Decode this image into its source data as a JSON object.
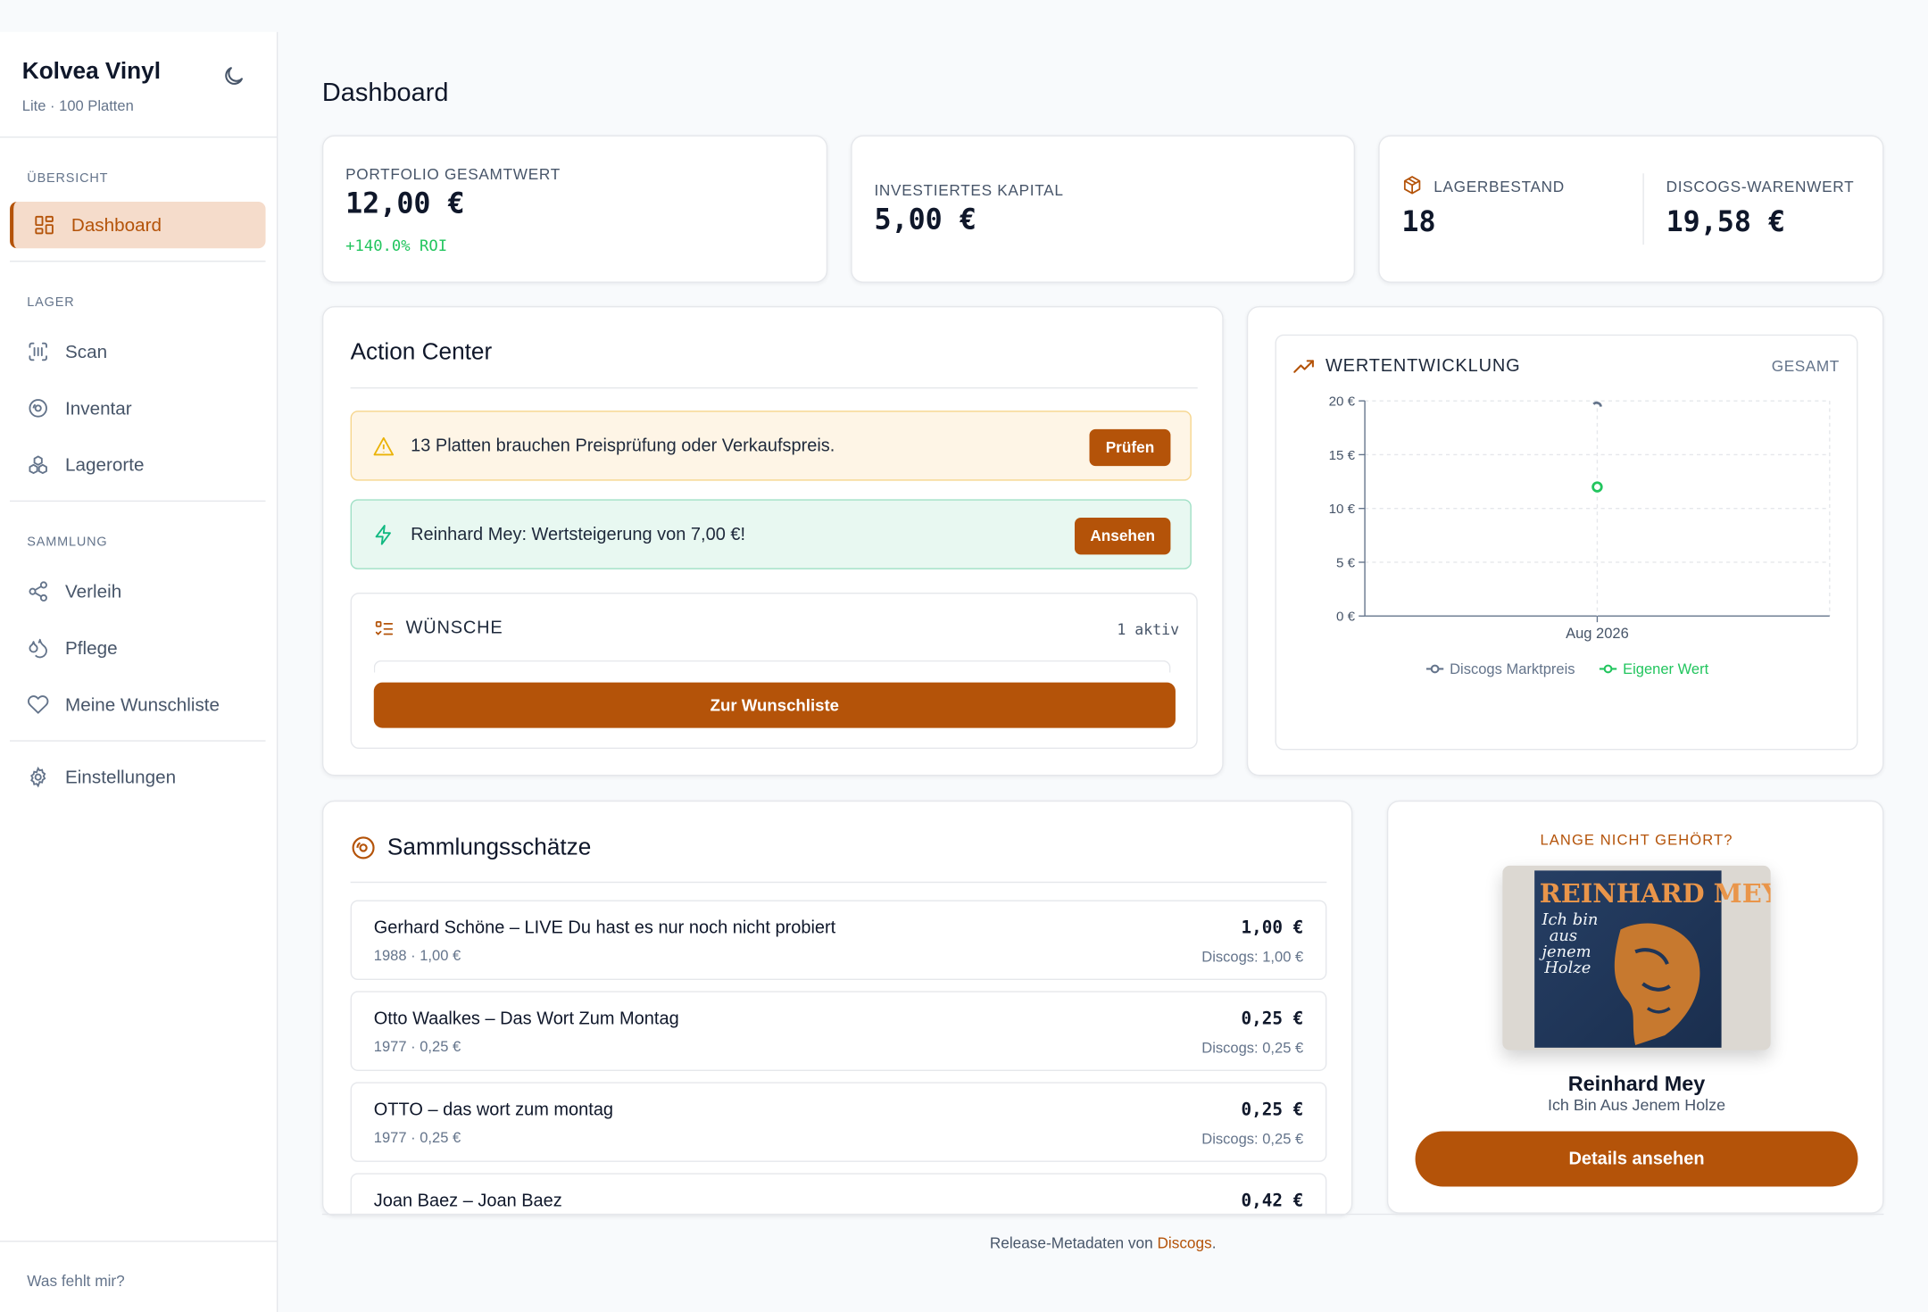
{
  "app": {
    "name": "Kolvea Vinyl",
    "plan": "Lite · 100 Platten"
  },
  "sidebar": {
    "sections": [
      {
        "title": "Übersicht",
        "items": [
          {
            "label": "Dashboard",
            "icon": "grid-icon",
            "active": true
          }
        ]
      },
      {
        "title": "Lager",
        "items": [
          {
            "label": "Scan",
            "icon": "barcode-scan-icon"
          },
          {
            "label": "Inventar",
            "icon": "vinyl-disc-icon"
          },
          {
            "label": "Lagerorte",
            "icon": "boxes-icon"
          }
        ]
      },
      {
        "title": "Sammlung",
        "items": [
          {
            "label": "Verleih",
            "icon": "share-icon"
          },
          {
            "label": "Pflege",
            "icon": "droplets-icon"
          },
          {
            "label": "Meine Wunschliste",
            "icon": "heart-icon"
          }
        ]
      }
    ],
    "settings_label": "Einstellungen",
    "footer_link": "Was fehlt mir?"
  },
  "page": {
    "title": "Dashboard"
  },
  "kpis": {
    "portfolio": {
      "label": "Portfolio Gesamtwert",
      "value": "12,00 €",
      "roi": "+140.0% ROI"
    },
    "invested": {
      "label": "Investiertes Kapital",
      "value": "5,00 €"
    },
    "stock": {
      "label": "Lagerbestand",
      "value": "18"
    },
    "discogs": {
      "label": "Discogs-Warenwert",
      "value": "19,58 €"
    }
  },
  "action_center": {
    "title": "Action Center",
    "alerts": [
      {
        "text": "13 Platten brauchen Preisprüfung oder Verkaufspreis.",
        "button": "Prüfen",
        "kind": "warning",
        "bg": "#fef5e6",
        "border": "#f6d58c",
        "icon_color": "#eab308"
      },
      {
        "text": "Reinhard Mey: Wertsteigerung von 7,00 €!",
        "button": "Ansehen",
        "kind": "success",
        "bg": "#e8f8f1",
        "border": "#9fe0c5",
        "icon_color": "#10b981"
      }
    ],
    "wishes": {
      "title": "Wünsche",
      "count": "1 aktiv",
      "button": "Zur Wunschliste"
    }
  },
  "chart_card": {
    "title": "Wertentwicklung",
    "range": "Gesamt"
  },
  "chart_data": {
    "type": "line",
    "x": [
      "Aug 2026"
    ],
    "series": [
      {
        "name": "Discogs Marktpreis",
        "values": [
          19.58
        ],
        "color": "#64748b"
      },
      {
        "name": "Eigener Wert",
        "values": [
          12
        ],
        "color": "#22c55e"
      }
    ],
    "yticks": [
      "0 €",
      "5 €",
      "10 €",
      "15 €",
      "20 €"
    ],
    "ylim": [
      0,
      20
    ],
    "grid": true,
    "legend": "bottom"
  },
  "treasures": {
    "title": "Sammlungsschätze",
    "items": [
      {
        "name": "Gerhard Schöne – LIVE Du hast es nur noch nicht probiert",
        "meta": "1988 · 1,00 €",
        "price": "1,00 €",
        "discogs": "Discogs: 1,00 €"
      },
      {
        "name": "Otto Waalkes – Das Wort Zum Montag",
        "meta": "1977 · 0,25 €",
        "price": "0,25 €",
        "discogs": "Discogs: 0,25 €"
      },
      {
        "name": "OTTO – das wort zum montag",
        "meta": "1977 · 0,25 €",
        "price": "0,25 €",
        "discogs": "Discogs: 0,25 €"
      },
      {
        "name": "Joan Baez – Joan Baez",
        "meta": "",
        "price": "0,42 €",
        "discogs": ""
      }
    ]
  },
  "recommendation": {
    "kicker": "Lange nicht gehört?",
    "artist": "Reinhard Mey",
    "album": "Ich Bin Aus Jenem Holze",
    "cover_title": "REINHARD MEY",
    "cover_subtitle": [
      "Ich bin",
      "aus",
      "jenem",
      "Holze"
    ],
    "button": "Details ansehen"
  },
  "footer": {
    "prefix": "Release-Metadaten von ",
    "link": "Discogs",
    "suffix": "."
  },
  "colors": {
    "accent": "#b45309",
    "accent_soft": "#f5dccb",
    "positive": "#22c55e"
  }
}
